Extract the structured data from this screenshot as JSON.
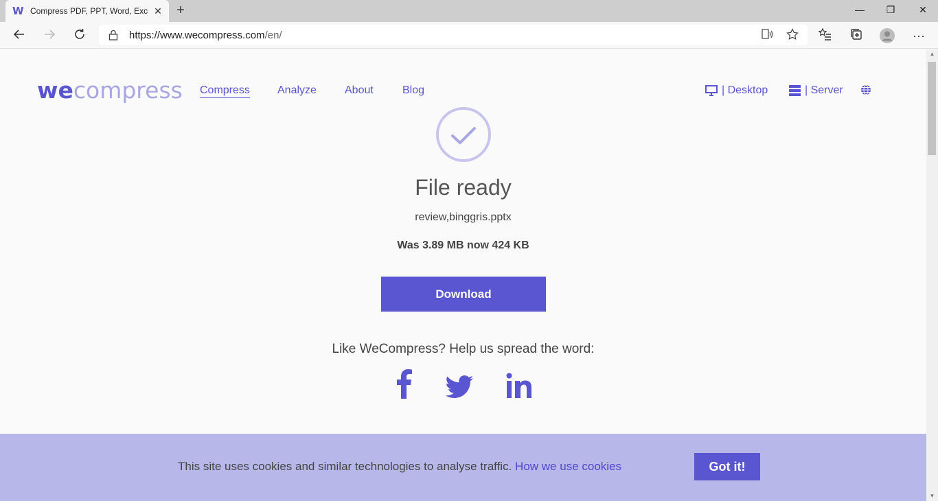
{
  "browser": {
    "tab_favicon": "W",
    "tab_title": "Compress PDF, PPT, Word, Excel",
    "tab_close": "✕",
    "new_tab": "+",
    "minimize": "—",
    "restore": "❐",
    "close": "✕",
    "url_host": "https://www.wecompress.com",
    "url_path": "/en/",
    "more": "···"
  },
  "site": {
    "logo_we": "we",
    "logo_rest": "compress",
    "nav": {
      "compress": "Compress",
      "analyze": "Analyze",
      "about": "About",
      "blog": "Blog"
    },
    "desktop": "| Desktop",
    "server": "| Server"
  },
  "result": {
    "title": "File ready",
    "filename": "review,binggris.pptx",
    "sizes": "Was 3.89 MB now 424 KB",
    "download_label": "Download",
    "share_text": "Like WeCompress? Help us spread the word:"
  },
  "cookie": {
    "text": "This site uses cookies and similar technologies to analyse traffic.",
    "link": "How we use cookies",
    "button": "Got it!"
  },
  "colors": {
    "brand": "#5a55d0",
    "brand_light": "#a9a6e3",
    "cookie_bg": "#b8b7ea"
  }
}
